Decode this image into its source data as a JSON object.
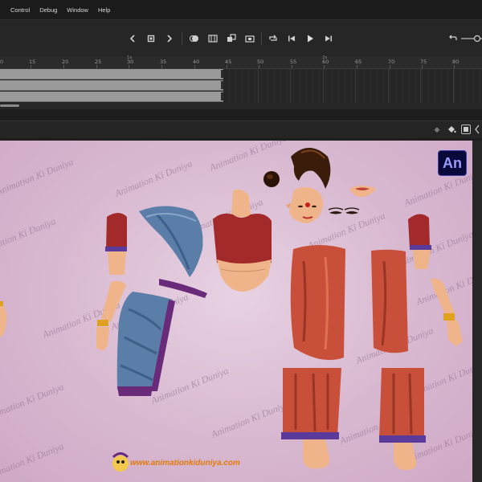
{
  "menu": [
    "Control",
    "Debug",
    "Window",
    "Help"
  ],
  "toolbar": {
    "icons": [
      "chevron-left-icon",
      "stop-icon",
      "chevron-right-icon",
      "onion-skin-icon",
      "edit-multiple-frames-icon",
      "insert-keyframe-icon",
      "insert-blank-keyframe-icon",
      "loop-icon",
      "step-back-icon",
      "play-icon",
      "step-forward-icon",
      "undo-icon"
    ]
  },
  "ruler": {
    "labels": [
      "0",
      "15",
      "20",
      "25",
      "30",
      "35",
      "40",
      "45",
      "50",
      "55",
      "60",
      "65",
      "70",
      "75",
      "80"
    ],
    "seconds": [
      "1s",
      "2s"
    ]
  },
  "timeline": {
    "layer_count": 3,
    "last_frame": 45
  },
  "stage": {
    "watermark_text": "Animation Ki Duniya",
    "logo_text": "An",
    "brand_url": "www.animationkiduniya.com",
    "background": "#d8b8d0"
  },
  "colors": {
    "blouse": "#a32a2a",
    "saree_red": "#c8503a",
    "saree_blue": "#5a7ea8",
    "border_purple": "#6a2a7a",
    "skin": "#f0b48a"
  }
}
